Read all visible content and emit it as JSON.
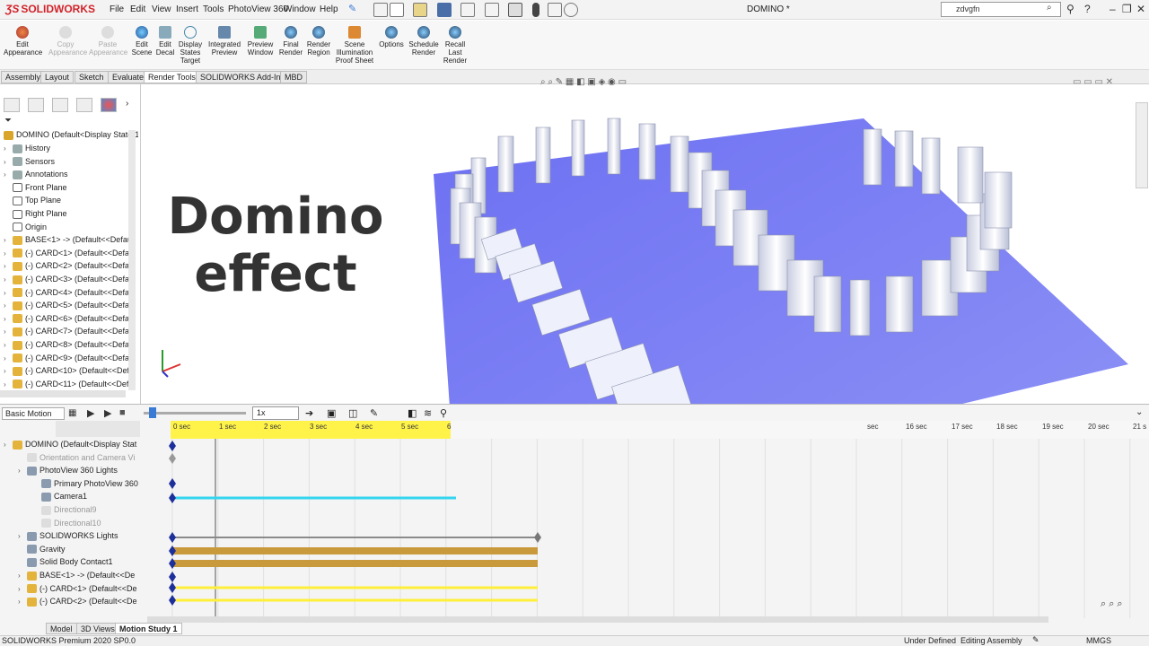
{
  "titlebar": {
    "brand": "SOLIDWORKS",
    "menus": [
      "File",
      "Edit",
      "View",
      "Insert",
      "Tools",
      "PhotoView 360",
      "Window",
      "Help"
    ],
    "document_title": "DOMINO *",
    "search_value": "zdvgfn"
  },
  "commands": [
    {
      "label": "Edit Appearance",
      "enabled": true
    },
    {
      "label": "Copy Appearance",
      "enabled": false
    },
    {
      "label": "Paste Appearance",
      "enabled": false
    },
    {
      "label": "Edit Scene",
      "enabled": true
    },
    {
      "label": "Edit Decal",
      "enabled": true
    },
    {
      "label": "Display States Target",
      "enabled": true
    },
    {
      "label": "Integrated Preview",
      "enabled": true
    },
    {
      "label": "Preview Window",
      "enabled": true
    },
    {
      "label": "Final Render",
      "enabled": true
    },
    {
      "label": "Render Region",
      "enabled": true
    },
    {
      "label": "Scene Illumination Proof Sheet",
      "enabled": true
    },
    {
      "label": "Options",
      "enabled": true
    },
    {
      "label": "Schedule Render",
      "enabled": true
    },
    {
      "label": "Recall Last Render",
      "enabled": true
    }
  ],
  "command_tabs": [
    "Assembly",
    "Layout",
    "Sketch",
    "Evaluate",
    "Render Tools",
    "SOLIDWORKS Add-Ins",
    "MBD"
  ],
  "active_command_tab": "Render Tools",
  "feature_tree": {
    "root": "DOMINO  (Default<Display State-1",
    "items": [
      "History",
      "Sensors",
      "Annotations",
      "Front Plane",
      "Top Plane",
      "Right Plane",
      "Origin",
      "BASE<1> -> (Default<<Defaul",
      "(-) CARD<1> (Default<<Defau",
      "(-) CARD<2> (Default<<Defau",
      "(-) CARD<3> (Default<<Defau",
      "(-) CARD<4> (Default<<Defau",
      "(-) CARD<5> (Default<<Defau",
      "(-) CARD<6> (Default<<Defau",
      "(-) CARD<7> (Default<<Defau",
      "(-) CARD<8> (Default<<Defau",
      "(-) CARD<9> (Default<<Defau",
      "(-) CARD<10> (Default<<Defa",
      "(-) CARD<11> (Default<<Defa"
    ]
  },
  "overlay": {
    "line1": "Domino",
    "line2": "effect"
  },
  "motion": {
    "study_type": "Basic Motion",
    "playback_speed": "1x",
    "time_labels": [
      "0 sec",
      "1 sec",
      "2 sec",
      "3 sec",
      "4 sec",
      "5 sec",
      "6",
      "sec",
      "16 sec",
      "17 sec",
      "18 sec",
      "19 sec",
      "20 sec",
      "21 s"
    ],
    "tree": [
      "DOMINO  (Default<Display Stat",
      "Orientation and Camera Vi",
      "PhotoView 360 Lights",
      "Primary PhotoView 360",
      "Camera1",
      "Directional9",
      "Directional10",
      "SOLIDWORKS Lights",
      "Gravity",
      "Solid Body Contact1",
      "BASE<1> -> (Default<<De",
      "(-) CARD<1> (Default<<De",
      "(-) CARD<2> (Default<<De"
    ]
  },
  "bottom_tabs": [
    "Model",
    "3D Views",
    "Motion Study 1"
  ],
  "status": {
    "product": "SOLIDWORKS Premium 2020 SP0.0",
    "state": "Under Defined",
    "mode": "Editing Assembly",
    "units": "MMGS"
  },
  "colors": {
    "floor": "#6b6ef0",
    "card": "#e8ecf4",
    "timeline_yellow": "#ffef3a",
    "timeline_bar": "#c99a3b",
    "camera_line": "#34d5f0"
  }
}
